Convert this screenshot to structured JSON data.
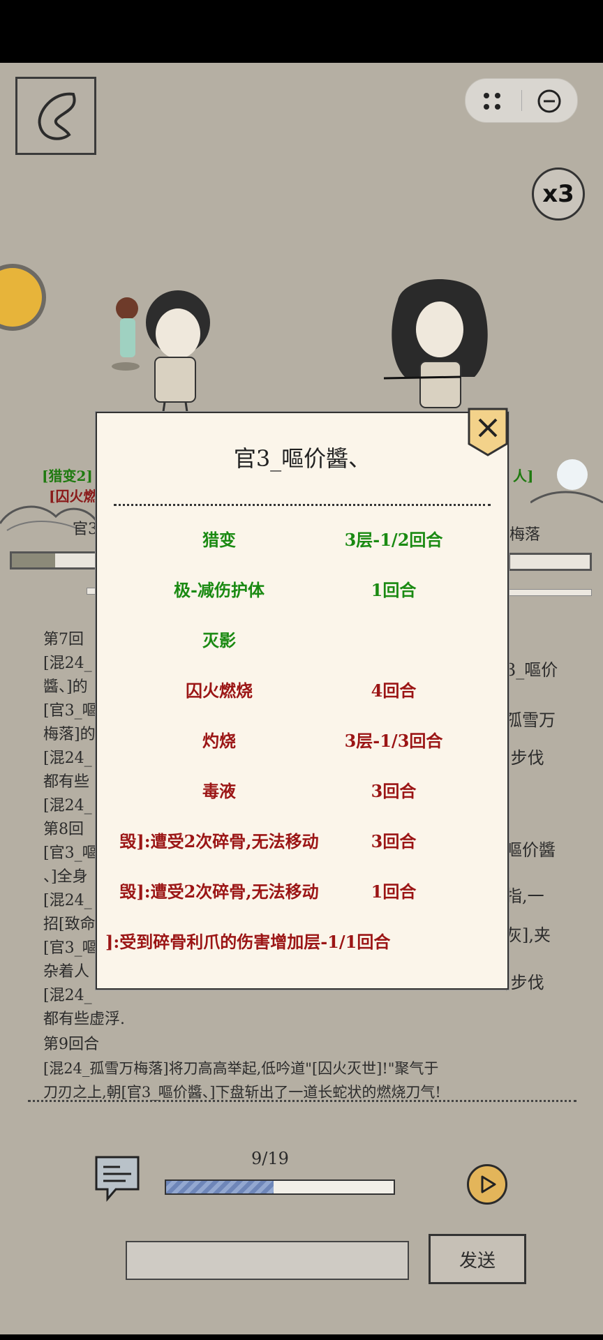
{
  "header": {
    "speed_label": "x3"
  },
  "left_fighter": {
    "status_line1": "[猎变2]",
    "status_line2": "[囚火燃",
    "name_partial": "官3"
  },
  "right_fighter": {
    "status_partial": "人] ",
    "name_partial": "梅落"
  },
  "battle_log_visible": [
    "第7回",
    "[混24_",
    "醬、]的",
    "[官3_嘔",
    "梅落]的",
    "[混24_",
    "都有些",
    "[混24_",
    "第8回",
    "[官3_嘔",
    "、]全身",
    "[混24_",
    "招[致命",
    "[官3_嘔",
    "杂着人",
    "[混24_",
    "都有些虚浮."
  ],
  "battle_log_right": [
    "3_嘔价",
    "孤雪万",
    ",步伐",
    "嘔价醬",
    "指,一",
    "灰],夹",
    ",步伐"
  ],
  "battle_log_bottom": [
    "第9回合",
    "[混24_孤雪万梅落]将刀高高举起,低吟道\"[囚火灭世]!\"聚气于",
    "刀刃之上,朝[官3_嘔价醬、]下盘斩出了一道长蛇状的燃烧刀气!"
  ],
  "progress": {
    "label": "9/19",
    "current": 9,
    "total": 19
  },
  "chat": {
    "send_label": "发送",
    "input_value": ""
  },
  "modal": {
    "title": "官3_嘔价醬、",
    "buffs": [
      {
        "name": "猎变",
        "duration": "3层-1/2回合",
        "type": "good"
      },
      {
        "name": "极-减伤护体",
        "duration": "1回合",
        "type": "good"
      },
      {
        "name": "灭影",
        "duration": "",
        "type": "good"
      },
      {
        "name": "囚火燃烧",
        "duration": "4回合",
        "type": "bad"
      },
      {
        "name": "灼烧",
        "duration": "3层-1/3回合",
        "type": "bad"
      },
      {
        "name": "毒液",
        "duration": "3回合",
        "type": "bad"
      },
      {
        "name": "毁]:遭受2次碎骨,无法移动",
        "duration": "3回合",
        "type": "bad"
      },
      {
        "name": "毁]:遭受2次碎骨,无法移动",
        "duration": "1回合",
        "type": "bad"
      },
      {
        "name": "]:受到碎骨利爪的伤害增加层-1/1回合",
        "duration": "",
        "type": "bad"
      }
    ]
  },
  "colors": {
    "buff_good": "#1a8a12",
    "buff_bad": "#9b1515",
    "progress_fill": "#6e86b8"
  },
  "bars": {
    "left_hp_fraction": 0.22,
    "right_hp_fraction": 0.98
  }
}
